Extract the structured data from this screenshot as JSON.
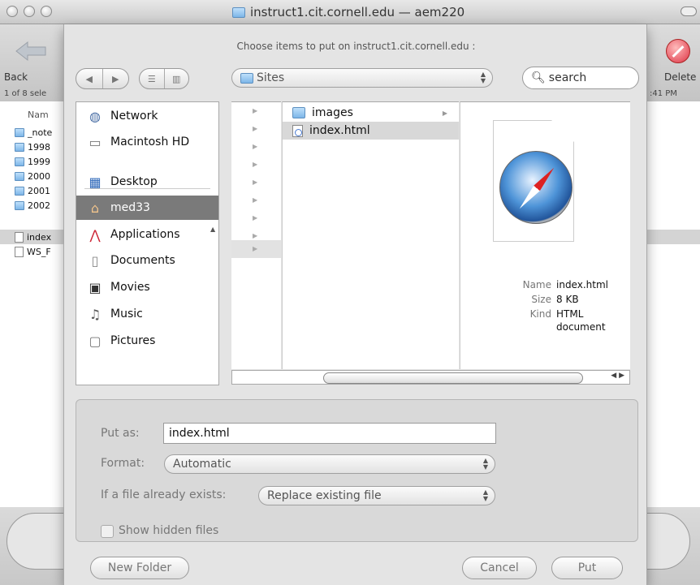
{
  "window": {
    "title": "instruct1.cit.cornell.edu — aem220"
  },
  "background": {
    "back_label": "Back",
    "delete_label": "Delete",
    "status_left": "1 of 8 sele",
    "status_right": ":41 PM",
    "column_header": "Nam",
    "items": [
      "_note",
      "1998",
      "1999",
      "2000",
      "2001",
      "2002",
      "index",
      "WS_F"
    ]
  },
  "sheet": {
    "message": "Choose items to put on instruct1.cit.cornell.edu :",
    "location": "Sites",
    "search_placeholder": "search",
    "sidebar": {
      "items": [
        {
          "label": "Network",
          "icon": "globe-icon"
        },
        {
          "label": "Macintosh HD",
          "icon": "hard-drive-icon"
        },
        {
          "label": "Desktop",
          "icon": "desktop-icon"
        },
        {
          "label": "med33",
          "icon": "home-icon",
          "selected": true
        },
        {
          "label": "Applications",
          "icon": "applications-icon"
        },
        {
          "label": "Documents",
          "icon": "documents-icon"
        },
        {
          "label": "Movies",
          "icon": "movies-icon"
        },
        {
          "label": "Music",
          "icon": "music-icon"
        },
        {
          "label": "Pictures",
          "icon": "pictures-icon"
        }
      ]
    },
    "files": [
      {
        "name": "images",
        "type": "folder"
      },
      {
        "name": "index.html",
        "type": "html",
        "selected": true
      }
    ],
    "preview": {
      "name_key": "Name",
      "name_value": "index.html",
      "size_key": "Size",
      "size_value": "8 KB",
      "kind_key": "Kind",
      "kind_value_line1": "HTML",
      "kind_value_line2": "document"
    },
    "options": {
      "put_as_label": "Put as:",
      "put_as_value": "index.html",
      "format_label": "Format:",
      "format_value": "Automatic",
      "exists_label": "If a file already exists:",
      "exists_value": "Replace existing file",
      "show_hidden_label": "Show hidden files"
    },
    "buttons": {
      "new_folder": "New Folder",
      "cancel": "Cancel",
      "put": "Put"
    }
  }
}
